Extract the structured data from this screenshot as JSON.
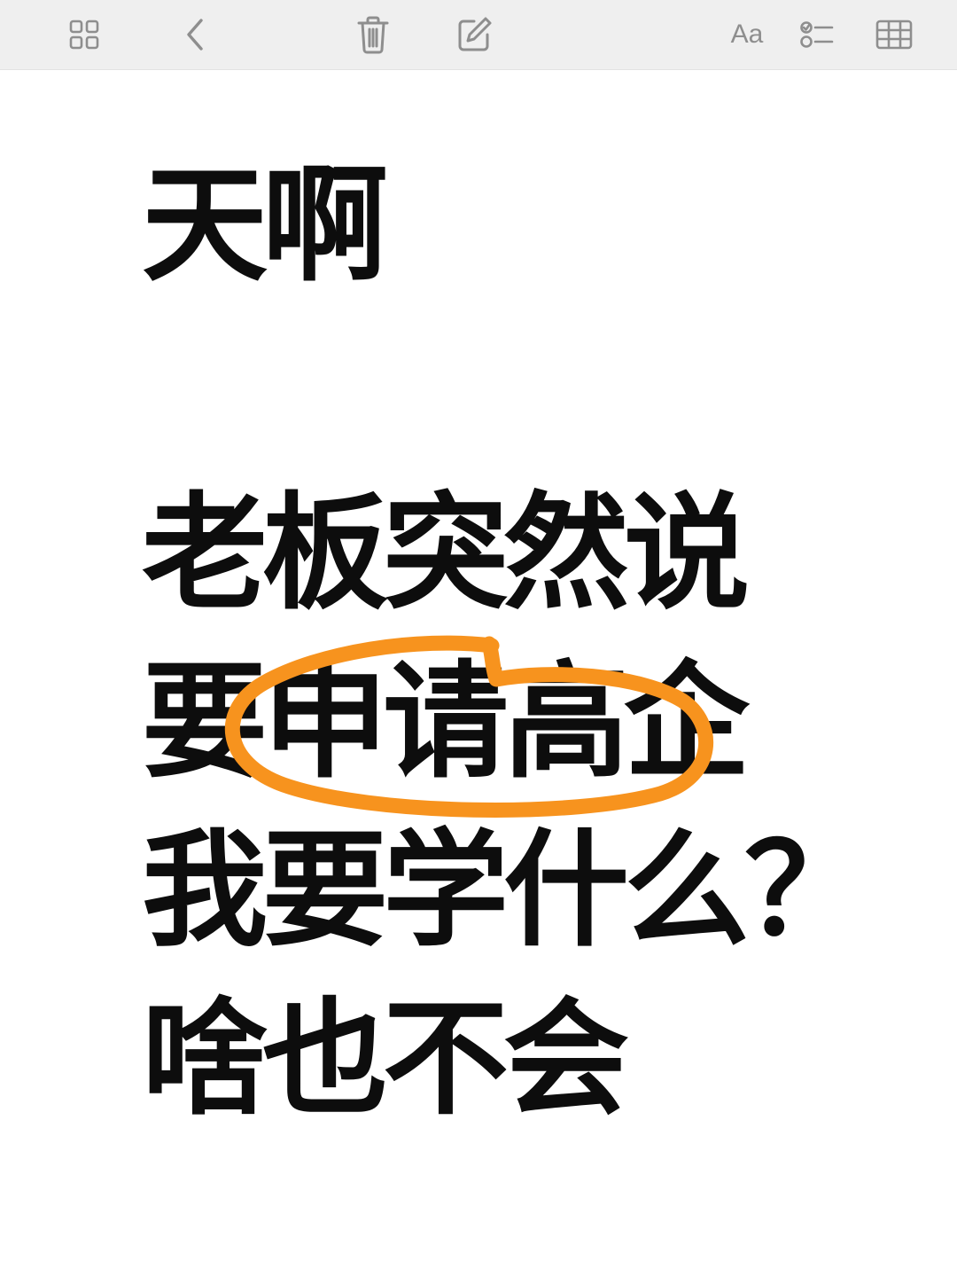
{
  "toolbar": {
    "items": [
      {
        "name": "gallery-view-icon"
      },
      {
        "name": "back-icon"
      },
      {
        "name": "trash-icon"
      },
      {
        "name": "compose-icon"
      },
      {
        "name": "text-format-button",
        "label": "Aa"
      },
      {
        "name": "checklist-icon"
      },
      {
        "name": "table-icon"
      }
    ],
    "format_label": "Aa",
    "icon_color": "#8e8e8e",
    "background_color": "#efefef"
  },
  "note": {
    "lines": [
      "天啊",
      "老板突然说",
      "要申请高企",
      "我要学什么？",
      "啥也不会"
    ],
    "highlight": {
      "text": "申请高企",
      "color": "#f7931e"
    },
    "text_color": "#0d0d0d"
  }
}
